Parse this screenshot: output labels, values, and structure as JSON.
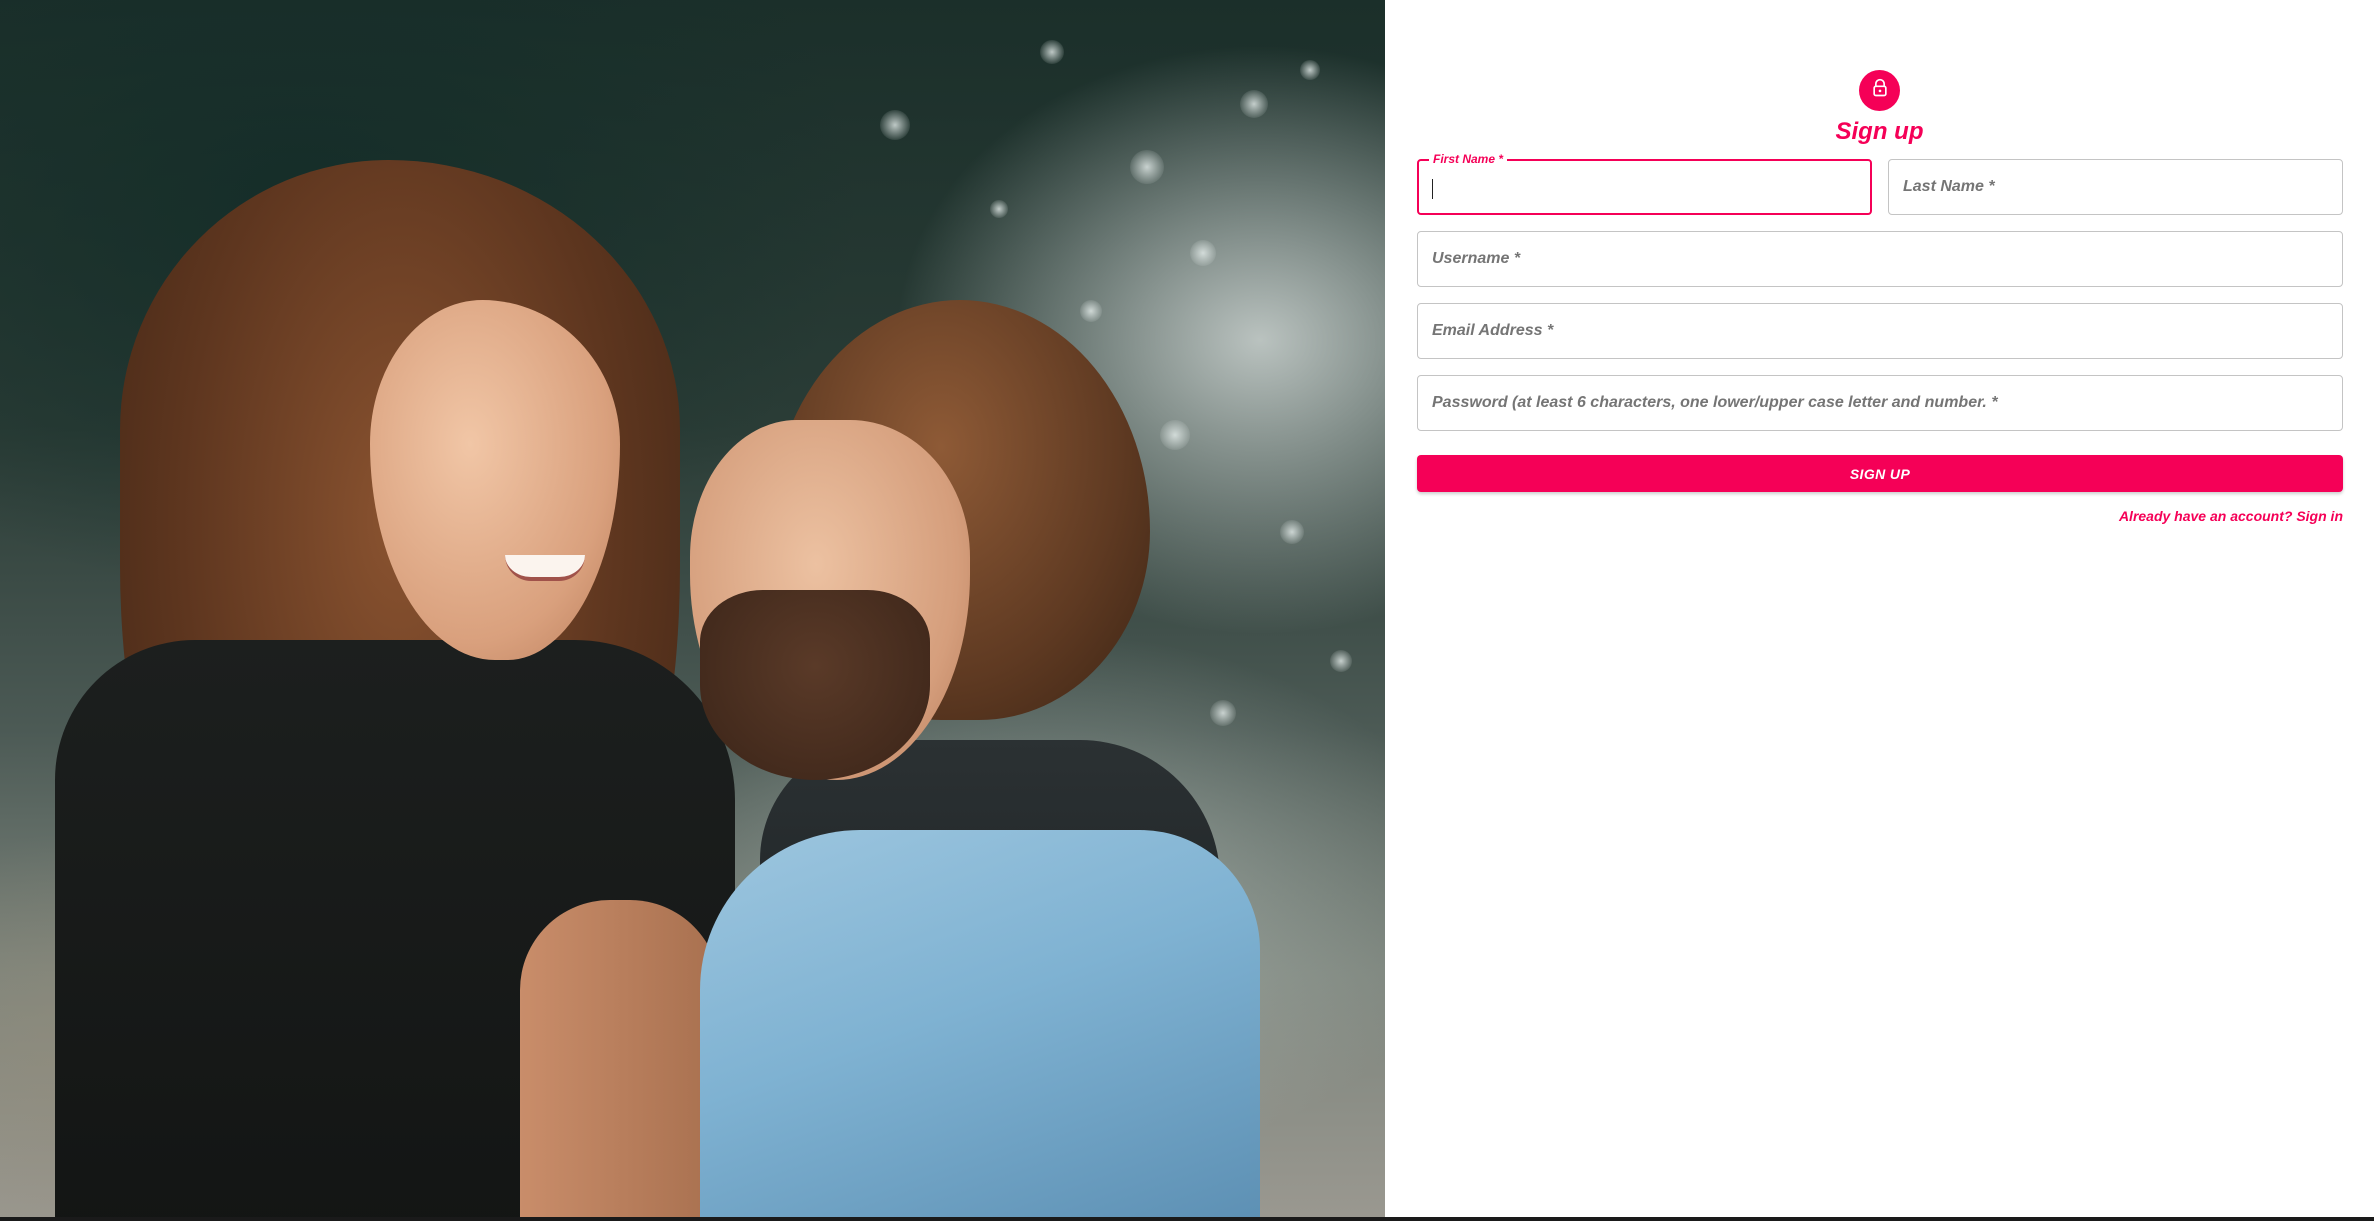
{
  "form": {
    "title": "Sign up",
    "icon": "lock-icon",
    "fields": {
      "first_name": {
        "label": "First Name *",
        "value": ""
      },
      "last_name": {
        "placeholder": "Last Name *",
        "value": ""
      },
      "username": {
        "placeholder": "Username *",
        "value": ""
      },
      "email": {
        "placeholder": "Email Address *",
        "value": ""
      },
      "password": {
        "placeholder": "Password (at least 6 characters, one lower/upper case letter and number. *",
        "value": ""
      }
    },
    "submit_label": "SIGN UP",
    "signin_link": "Already have an account? Sign in"
  },
  "colors": {
    "accent": "#f50057",
    "border": "#c4c4c4",
    "placeholder": "#757575"
  }
}
